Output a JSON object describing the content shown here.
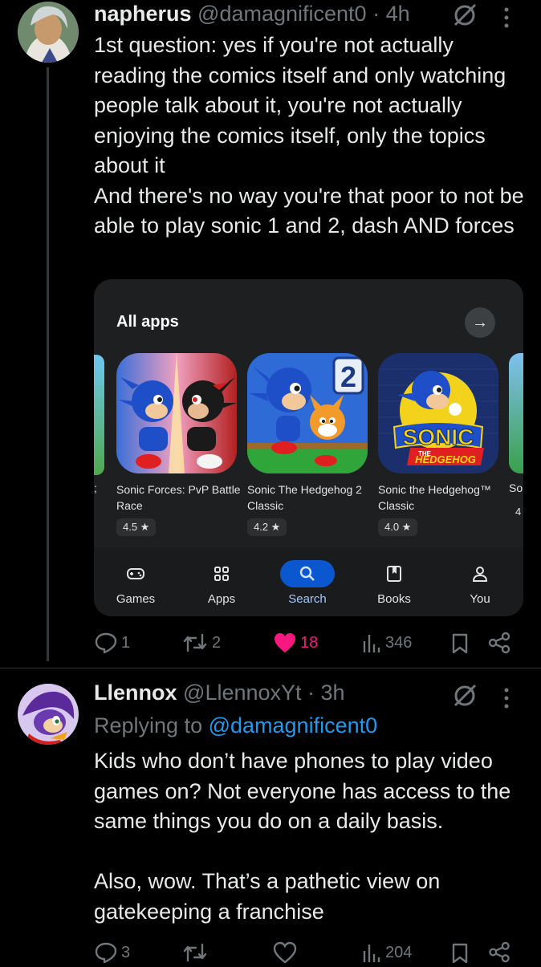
{
  "tweet1": {
    "display_name": "napherus",
    "handle": "@damagnificent0",
    "time": "· 4h",
    "text": "1st question: yes if you're not actually reading the comics itself and only watching people talk about it, you're not actually enjoying the comics itself, only the topics about it\nAnd there's no way you're that poor to not be able to play sonic 1 and 2, dash AND forces",
    "more_icon": "more-vertical-icon",
    "stats": {
      "replies": "1",
      "retweets": "2",
      "likes": "18",
      "views": "346"
    }
  },
  "playstore": {
    "section_title": "All apps",
    "apps": [
      {
        "name": "Sonic Forces: PvP Battle Race",
        "rating": "4.5 ★"
      },
      {
        "name": "Sonic The Hedgehog 2 Classic",
        "rating": "4.2 ★"
      },
      {
        "name": "Sonic the Hedgehog™ Classic",
        "rating": "4.0 ★"
      },
      {
        "name": "So",
        "rating": "4"
      }
    ],
    "nav": [
      {
        "label": "Games",
        "icon": "gamepad-icon"
      },
      {
        "label": "Apps",
        "icon": "apps-grid-icon"
      },
      {
        "label": "Search",
        "icon": "search-icon"
      },
      {
        "label": "Books",
        "icon": "book-icon"
      },
      {
        "label": "You",
        "icon": "person-icon"
      }
    ],
    "logo_text": {
      "sonic": "SONIC",
      "the": "THE",
      "hedgehog": "HEDGEHOG",
      "two": "2"
    }
  },
  "tweet2": {
    "display_name": "Llennox",
    "handle": "@LlennoxYt",
    "time": "· 3h",
    "replying_prefix": "Replying to ",
    "replying_to": "@damagnificent0",
    "text": "Kids who don’t have phones to play video games on? Not everyone has access to the same things you do on a daily basis.\n\nAlso, wow. That’s a pathetic view on gatekeeping a franchise",
    "stats": {
      "replies": "3",
      "retweets": "",
      "likes": "",
      "views": "204"
    }
  },
  "colors": {
    "like": "#f91880",
    "link": "#1d9bf0",
    "muted": "#71767b",
    "search_accent": "#a8c7fa"
  }
}
